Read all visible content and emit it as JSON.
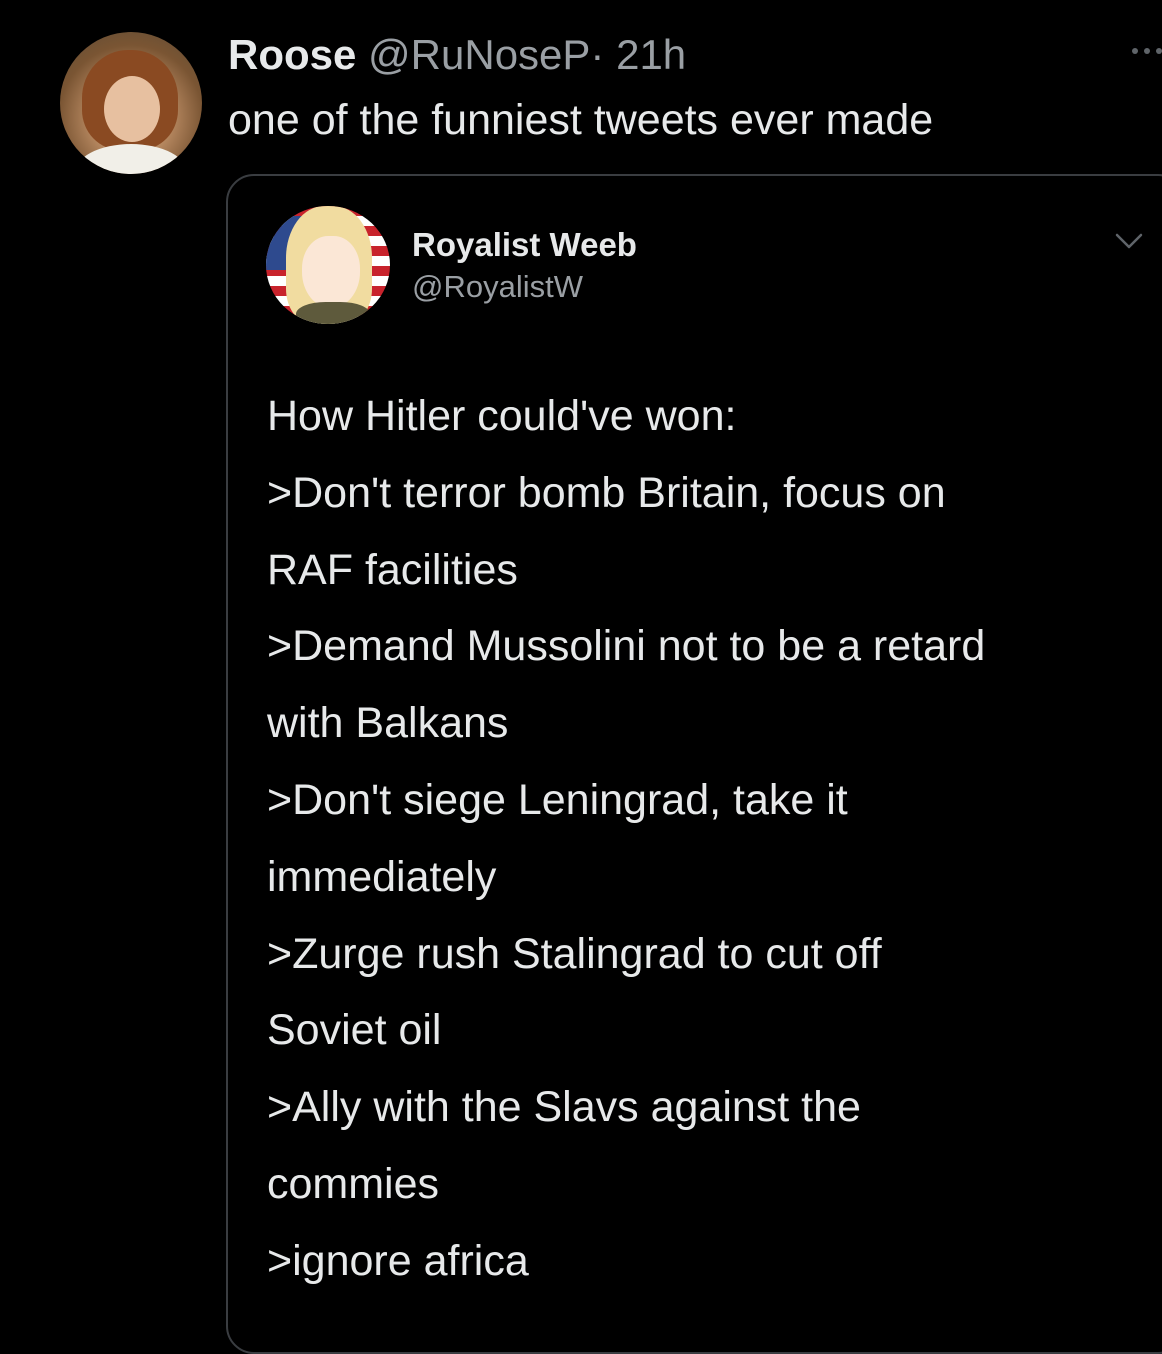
{
  "tweet": {
    "display_name": "Roose",
    "handle": "@RuNoseP",
    "separator": "·",
    "time": "21h",
    "text": "one of the funniest tweets ever made"
  },
  "quoted_tweet": {
    "display_name": "Royalist Weeb",
    "handle": "@RoyalistW",
    "lines": [
      "How Hitler could've won:",
      ">Don't terror bomb Britain, focus on",
      "RAF facilities",
      ">Demand Mussolini not to be a retard",
      "with Balkans",
      ">Don't siege Leningrad, take it",
      "immediately",
      ">Zurge rush Stalingrad to cut off",
      "Soviet oil",
      ">Ally with the Slavs against the",
      "commies",
      ">ignore africa"
    ]
  },
  "icons": {
    "more": "more-icon",
    "chevron": "chevron-down-icon"
  },
  "colors": {
    "background": "#000000",
    "primary_text": "#e7e9ea",
    "secondary_text": "#9a9fa4",
    "card_border": "#3a3d41"
  }
}
